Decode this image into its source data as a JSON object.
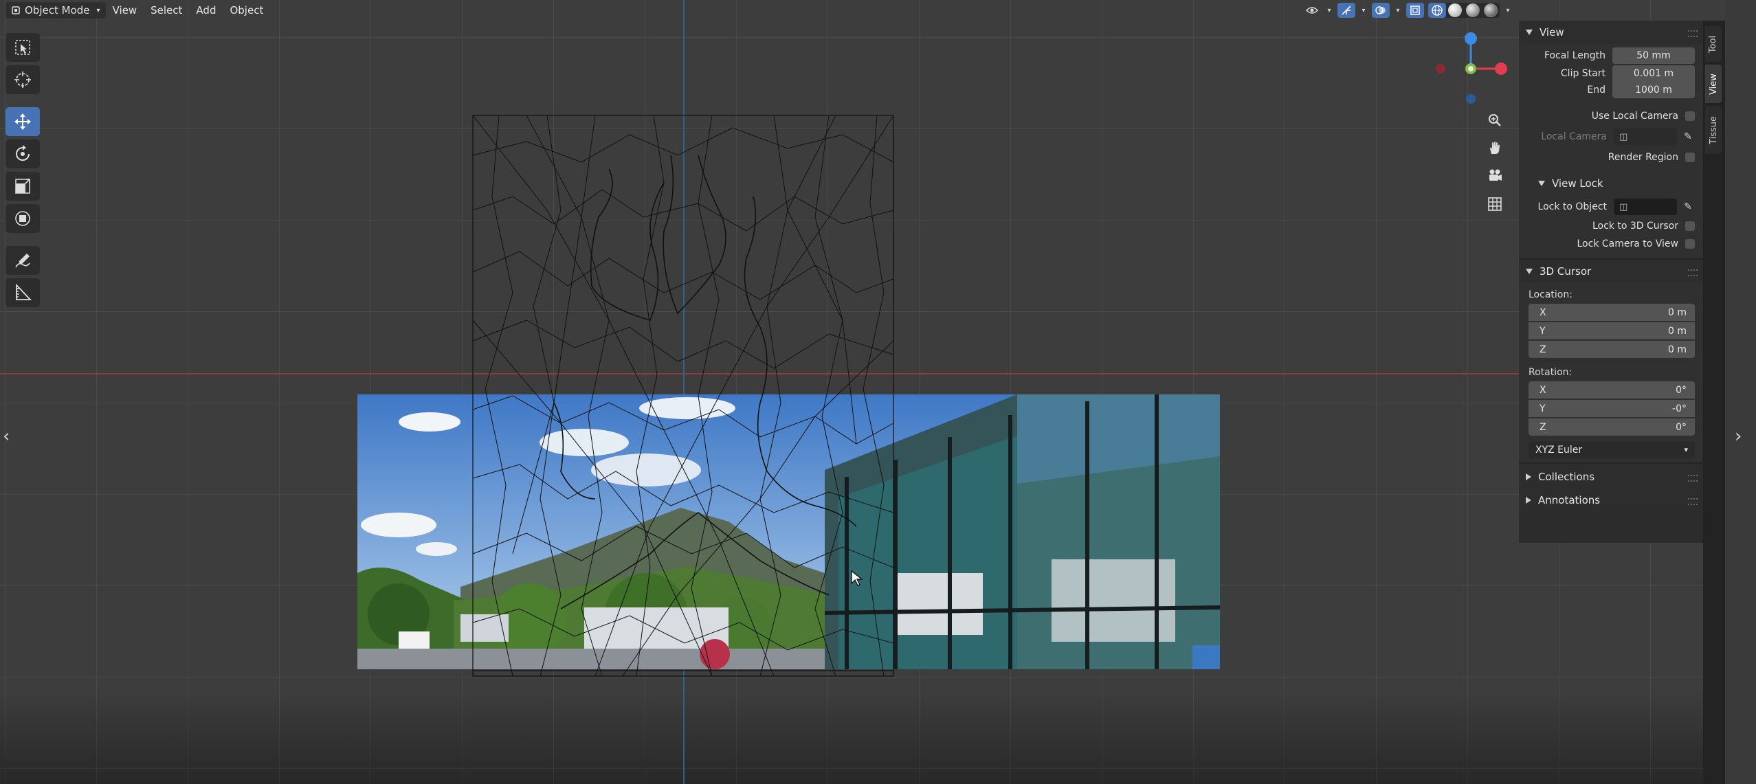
{
  "header": {
    "mode": "Object Mode",
    "menu": [
      "View",
      "Select",
      "Add",
      "Object"
    ]
  },
  "gizmo": {
    "x_color": "#e23c4f",
    "y_color": "#7fbf3f",
    "z_color": "#3c8ce7"
  },
  "npanel": {
    "view": {
      "title": "View",
      "focal_length_label": "Focal Length",
      "focal_length_value": "50 mm",
      "clip_start_label": "Clip Start",
      "clip_start_value": "0.001 m",
      "end_label": "End",
      "end_value": "1000 m",
      "use_local_camera_label": "Use Local Camera",
      "local_camera_label": "Local Camera",
      "render_region_label": "Render Region"
    },
    "view_lock": {
      "title": "View Lock",
      "lock_to_object_label": "Lock to Object",
      "lock_to_3d_cursor_label": "Lock to 3D Cursor",
      "lock_camera_to_view_label": "Lock Camera to View"
    },
    "cursor": {
      "title": "3D Cursor",
      "location_label": "Location:",
      "location": [
        {
          "axis": "X",
          "value": "0 m"
        },
        {
          "axis": "Y",
          "value": "0 m"
        },
        {
          "axis": "Z",
          "value": "0 m"
        }
      ],
      "rotation_label": "Rotation:",
      "rotation": [
        {
          "axis": "X",
          "value": "0°"
        },
        {
          "axis": "Y",
          "value": "-0°"
        },
        {
          "axis": "Z",
          "value": "0°"
        }
      ],
      "rotation_mode": "XYZ Euler"
    },
    "collections_title": "Collections",
    "annotations_title": "Annotations"
  },
  "tabs": [
    "Tool",
    "View",
    "Tissue"
  ]
}
